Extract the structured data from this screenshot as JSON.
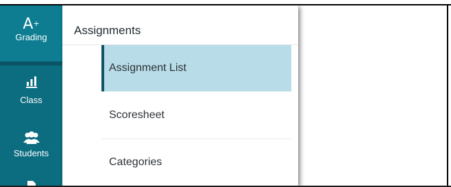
{
  "rail": {
    "items": [
      {
        "label": "Grading",
        "icon": "a-plus-icon"
      },
      {
        "label": "Class",
        "icon": "bar-chart-icon"
      },
      {
        "label": "Students",
        "icon": "users-icon"
      },
      {
        "label": "",
        "icon": "document-icon"
      }
    ]
  },
  "panel": {
    "title": "Assignments",
    "items": [
      {
        "label": "Assignment List",
        "selected": true
      },
      {
        "label": "Scoresheet",
        "selected": false
      },
      {
        "label": "Categories",
        "selected": false
      }
    ]
  },
  "colors": {
    "rail": "#0c6d80",
    "selected_bg": "#b8dce8",
    "selected_bar": "#10536a"
  }
}
